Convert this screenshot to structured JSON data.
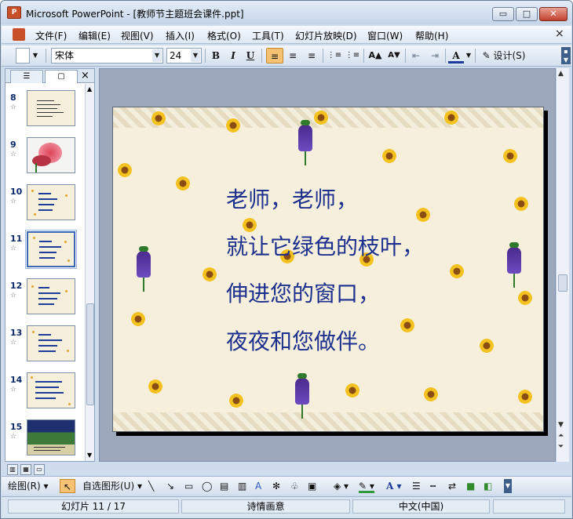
{
  "window": {
    "title": "Microsoft PowerPoint - [教师节主题班会课件.ppt]",
    "app_icon": "powerpoint-icon",
    "min_label": "▭",
    "max_label": "□",
    "close_label": "✕"
  },
  "menu": {
    "items": [
      "文件(F)",
      "编辑(E)",
      "视图(V)",
      "插入(I)",
      "格式(O)",
      "工具(T)",
      "幻灯片放映(D)",
      "窗口(W)",
      "帮助(H)"
    ],
    "close_label": "×"
  },
  "toolbar": {
    "font": "宋体",
    "size": "24",
    "bold": "B",
    "italic": "I",
    "underline": "U",
    "align_left": "≡",
    "align_center": "≡",
    "align_right": "≡",
    "numbered_list": "⋮≡",
    "bulleted_list": "⋮≡",
    "grow_font": "A▲",
    "shrink_font": "A▼",
    "decrease_indent": "⇤",
    "increase_indent": "⇥",
    "font_color": "A",
    "design_label": "设计(S)"
  },
  "pane": {
    "tab_outline": "☰",
    "tab_slides": "▢",
    "close_label": "×",
    "slides": [
      {
        "num": "8"
      },
      {
        "num": "9"
      },
      {
        "num": "10"
      },
      {
        "num": "11"
      },
      {
        "num": "12"
      },
      {
        "num": "13"
      },
      {
        "num": "14"
      },
      {
        "num": "15"
      }
    ],
    "star": "☆"
  },
  "slide": {
    "lines": [
      "老师，老师，",
      "就让它绿色的枝叶，",
      "伸进您的窗口，",
      "夜夜和您做伴。"
    ]
  },
  "drawbar": {
    "draw_label": "绘图(R)",
    "autoshapes_label": "自选图形(U)"
  },
  "status": {
    "slide_info": "幻灯片 11 / 17",
    "design_name": "诗情画意",
    "language": "中文(中国)"
  },
  "colors": {
    "slide_text": "#1b2f8e",
    "slide_bg": "#f6efdc",
    "selected_thumb_border": "#3b67b4"
  }
}
